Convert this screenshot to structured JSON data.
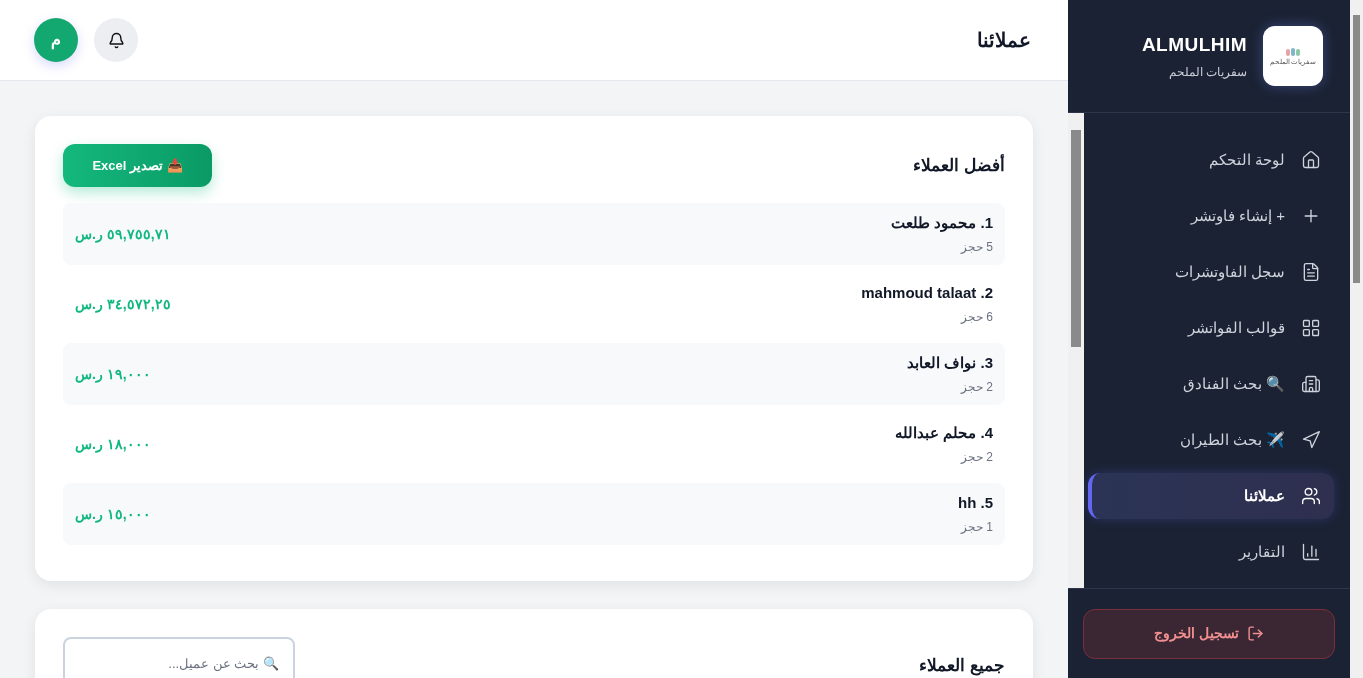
{
  "sidebar": {
    "brand": "ALMULHIM",
    "subtitle": "سفريات الملحم",
    "logo_text": "سفريات الملحم",
    "items": [
      {
        "label": "لوحة التحكم",
        "selected": false
      },
      {
        "label": "+ إنشاء فاوتشر",
        "selected": false
      },
      {
        "label": "سجل الفاوتشرات",
        "selected": false
      },
      {
        "label": "قوالب الفواتشر",
        "selected": false
      },
      {
        "label": "🔍 بحث الفنادق",
        "selected": false
      },
      {
        "label": "✈️ بحث الطيران",
        "selected": false
      },
      {
        "label": "عملائنا",
        "selected": true
      },
      {
        "label": "التقارير",
        "selected": false
      }
    ],
    "logout": "تسجيل الخروج"
  },
  "header": {
    "title": "عملائنا",
    "avatar": "م"
  },
  "top_customers": {
    "title": "أفضل العملاء",
    "export_button": "📥 تصدير Excel",
    "rows": [
      {
        "name": "1. محمود طلعت",
        "bookings": "5 حجز",
        "amount": "٥٩,٧٥٥,٧١ ر.س"
      },
      {
        "name": "2. mahmoud talaat",
        "bookings": "6 حجز",
        "amount": "٣٤,٥٧٢,٢٥ ر.س"
      },
      {
        "name": "3. نواف العابد",
        "bookings": "2 حجز",
        "amount": "١٩,٠٠٠ ر.س"
      },
      {
        "name": "4. محلم عبدالله",
        "bookings": "2 حجز",
        "amount": "١٨,٠٠٠ ر.س"
      },
      {
        "name": "5. hh",
        "bookings": "1 حجز",
        "amount": "١٥,٠٠٠ ر.س"
      }
    ]
  },
  "all_customers": {
    "title": "جميع العملاء",
    "search": {
      "placeholder": "🔍 بحث عن عميل..."
    }
  }
}
